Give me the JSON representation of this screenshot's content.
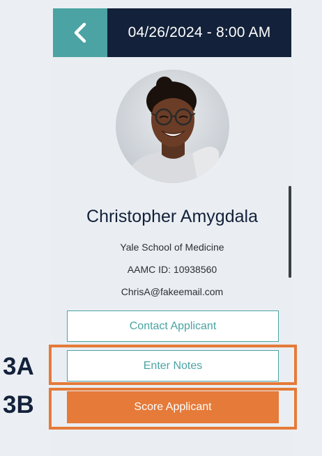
{
  "colors": {
    "header_bg": "#13213a",
    "accent_teal": "#4ba3a3",
    "accent_orange": "#e57a39",
    "background": "#ebeff3"
  },
  "header": {
    "back_icon": "chevron-left-icon",
    "datetime": "04/26/2024 - 8:00 AM"
  },
  "profile": {
    "name": "Christopher Amygdala",
    "school": "Yale School of Medicine",
    "aamc_id": "AAMC ID: 10938560",
    "email": "ChrisA@fakeemail.com"
  },
  "actions": {
    "contact_label": "Contact Applicant",
    "notes_label": "Enter Notes",
    "score_label": "Score Applicant"
  },
  "callouts": {
    "notes_marker": "3A",
    "score_marker": "3B"
  }
}
